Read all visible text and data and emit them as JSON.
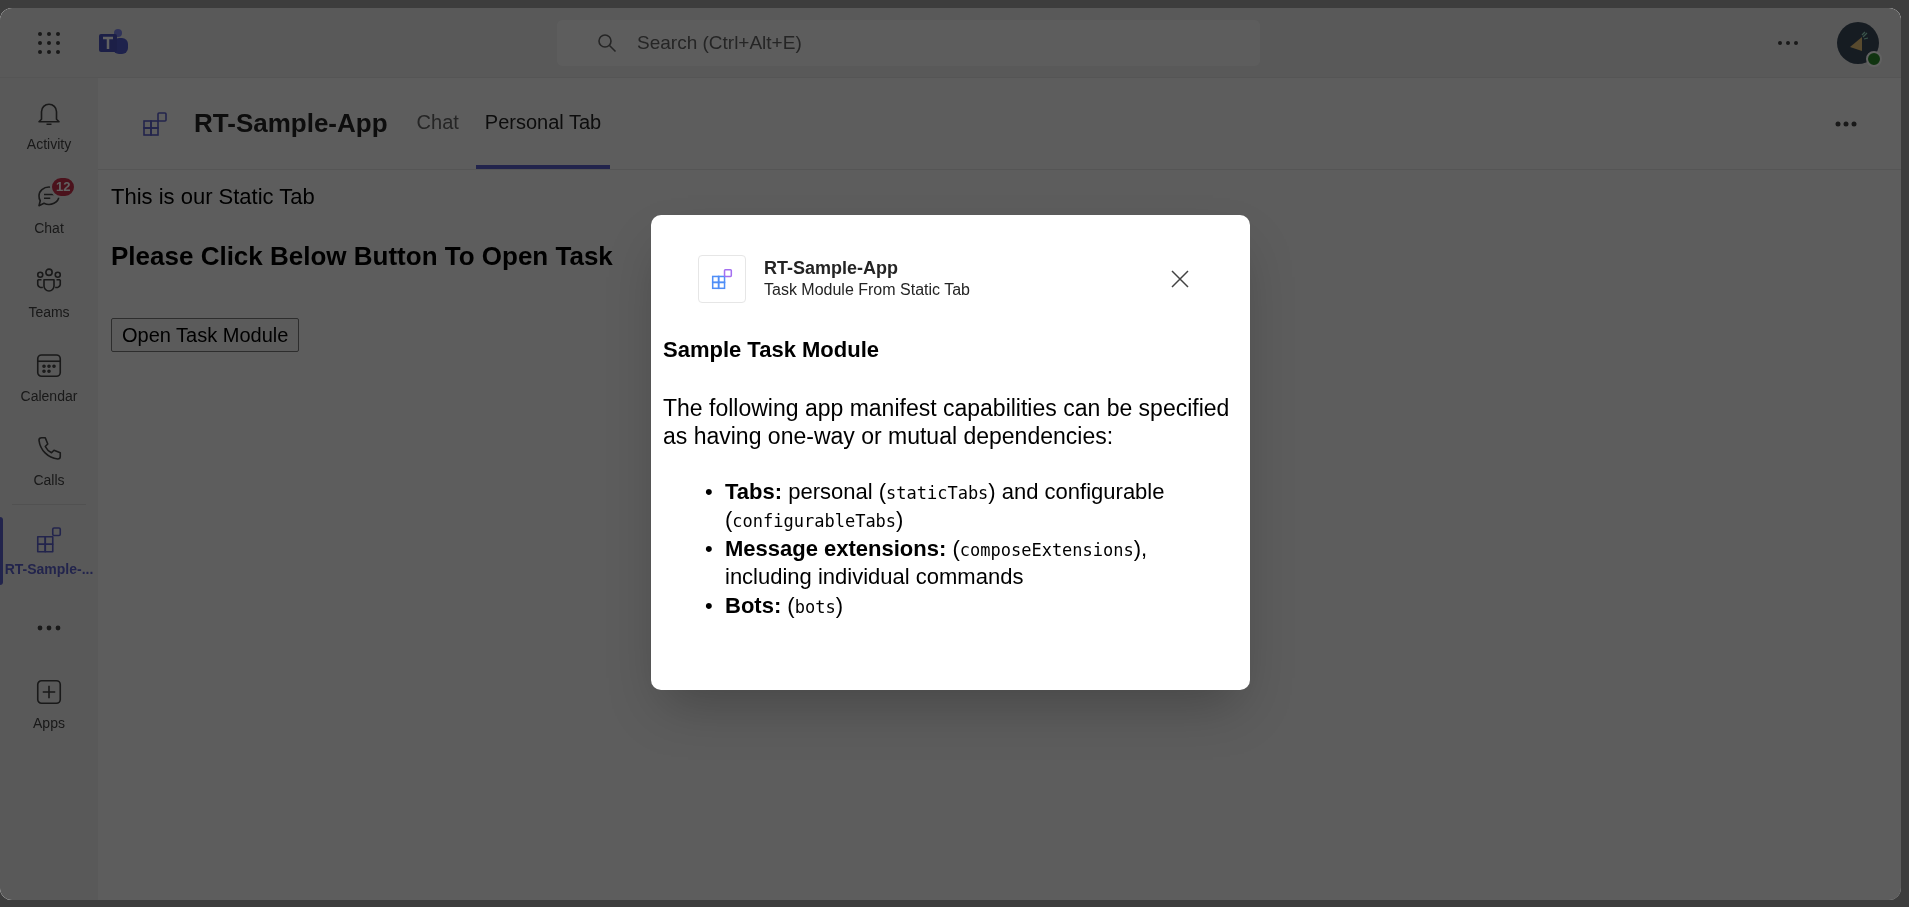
{
  "title_bar": {
    "search": {
      "placeholder": "Search (Ctrl+Alt+E)"
    }
  },
  "rail": [
    {
      "kind": "bell",
      "label": "Activity",
      "selected": false
    },
    {
      "kind": "chat",
      "label": "Chat",
      "badge": "12",
      "selected": false
    },
    {
      "kind": "teams",
      "label": "Teams",
      "selected": false
    },
    {
      "kind": "calendar",
      "label": "Calendar",
      "selected": false
    },
    {
      "kind": "calls",
      "label": "Calls",
      "selected": false
    },
    {
      "kind": "app",
      "label": "RT-Sample-...",
      "selected": true
    },
    {
      "kind": "more"
    },
    {
      "kind": "apps",
      "label": "Apps",
      "selected": false
    }
  ],
  "app_header": {
    "title": "RT-Sample-App",
    "tabs": [
      {
        "label": "Chat",
        "selected": false
      },
      {
        "label": "Personal Tab",
        "selected": true
      }
    ]
  },
  "content": {
    "intro": "This is our Static Tab",
    "heading": "Please Click Below Button To Open Task",
    "button": "Open Task Module"
  },
  "dialog": {
    "app_name": "RT-Sample-App",
    "subtitle": "Task Module From Static Tab",
    "heading": "Sample Task Module",
    "paragraph": "The following app manifest capabilities can be specified as having one-way or mutual dependencies:",
    "items": [
      {
        "marker": "•",
        "segments": [
          {
            "kind": "bold",
            "text": "Tabs:"
          },
          {
            "kind": "text",
            "text": " personal ("
          },
          {
            "kind": "code",
            "text": "staticTabs"
          },
          {
            "kind": "text",
            "text": ") and configurable ("
          },
          {
            "kind": "code",
            "text": "configurableTabs"
          },
          {
            "kind": "text",
            "text": ")"
          }
        ]
      },
      {
        "marker": "•",
        "segments": [
          {
            "kind": "bold",
            "text": "Message extensions:"
          },
          {
            "kind": "text",
            "text": " ("
          },
          {
            "kind": "code",
            "text": "composeExtensions"
          },
          {
            "kind": "text",
            "text": "), including individual commands"
          }
        ]
      },
      {
        "marker": "•",
        "segments": [
          {
            "kind": "bold",
            "text": "Bots:"
          },
          {
            "kind": "text",
            "text": " ("
          },
          {
            "kind": "code",
            "text": "bots"
          },
          {
            "kind": "text",
            "text": ")"
          }
        ]
      }
    ]
  }
}
